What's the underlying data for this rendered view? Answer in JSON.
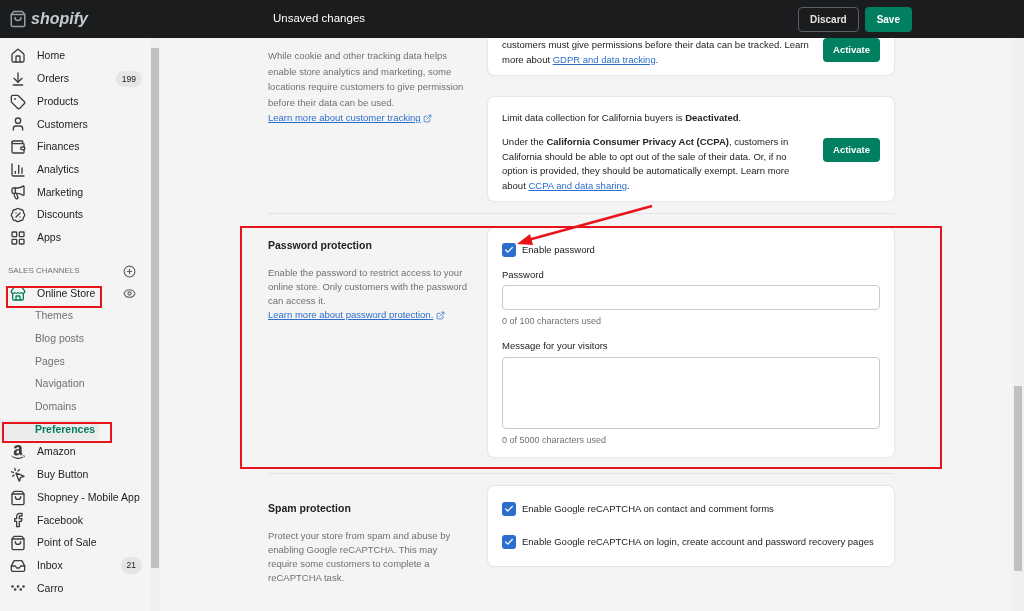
{
  "topbar": {
    "logo": "shopify",
    "title": "Unsaved changes",
    "buttons": [
      {
        "label": "Discard",
        "kind": "secondary"
      },
      {
        "label": "Save",
        "kind": "primary"
      }
    ]
  },
  "sidebar": {
    "items": [
      {
        "label": "Home",
        "kind": "main",
        "selected": false
      },
      {
        "label": "Orders",
        "kind": "main",
        "badge": "199",
        "selected": false
      },
      {
        "label": "Products",
        "kind": "main",
        "selected": false
      },
      {
        "label": "Customers",
        "kind": "main",
        "selected": false
      },
      {
        "label": "Finances",
        "kind": "main",
        "selected": false
      },
      {
        "label": "Analytics",
        "kind": "main",
        "selected": false
      },
      {
        "label": "Marketing",
        "kind": "main",
        "selected": false
      },
      {
        "label": "Discounts",
        "kind": "main",
        "selected": false
      },
      {
        "label": "Apps",
        "kind": "main",
        "selected": false
      }
    ],
    "section_title": "SALES CHANNELS",
    "channels": [
      {
        "label": "Online Store",
        "kind": "main",
        "selected": false
      },
      {
        "label": "Themes",
        "kind": "sub",
        "selected": false
      },
      {
        "label": "Blog posts",
        "kind": "sub",
        "selected": false
      },
      {
        "label": "Pages",
        "kind": "sub",
        "selected": false
      },
      {
        "label": "Navigation",
        "kind": "sub",
        "selected": false
      },
      {
        "label": "Domains",
        "kind": "sub",
        "selected": false
      },
      {
        "label": "Preferences",
        "kind": "sub",
        "selected": true
      },
      {
        "label": "Amazon",
        "kind": "main",
        "selected": false
      },
      {
        "label": "Buy Button",
        "kind": "main",
        "selected": false
      },
      {
        "label": "Shopney - Mobile App",
        "kind": "main",
        "selected": false
      },
      {
        "label": "Facebook",
        "kind": "main",
        "selected": false
      },
      {
        "label": "Point of Sale",
        "kind": "main",
        "selected": false
      },
      {
        "label": "Inbox",
        "kind": "main",
        "badge": "21",
        "selected": false
      },
      {
        "label": "Carro",
        "kind": "main",
        "selected": false
      }
    ]
  },
  "privacy": {
    "description": "While cookie and other tracking data helps enable store analytics and marketing, some locations require customers to give permission before their data can be used.",
    "link": "Learn more about customer tracking",
    "cards": [
      {
        "body": "customers must give permissions before their data can be tracked. Learn more about",
        "link": "GDPR and data tracking",
        "after": ".",
        "button": "Activate"
      },
      {
        "status": "Limit data collection for California buyers is **Deactivated**.",
        "body": "Under the **California Consumer Privacy Act (CCPA)**, customers in California should be able to opt out of the sale of their data. Or, if no option is provided, they should be automatically exempt. Learn more about",
        "link": "CCPA and data sharing",
        "after": ".",
        "button": "Activate"
      }
    ]
  },
  "password_protection": {
    "title": "Password protection",
    "description": "Enable the password to restrict access to your online store. Only customers with the password can access it.",
    "link": "Learn more about password protection.",
    "enable": {
      "label": "Enable password",
      "checked": true
    },
    "password": {
      "label": "Password",
      "counter": "0 of 100 characters used"
    },
    "message": {
      "label": "Message for your visitors",
      "counter": "0 of 5000 characters used"
    }
  },
  "spam_protection": {
    "title": "Spam protection",
    "description": "Protect your store from spam and abuse by enabling Google reCAPTCHA. This may require some customers to complete a reCAPTCHA task.",
    "options": [
      {
        "label": "Enable Google reCAPTCHA on contact and comment forms",
        "checked": true
      },
      {
        "label": "Enable Google reCAPTCHA on login, create account and password recovery pages",
        "checked": true
      }
    ]
  }
}
